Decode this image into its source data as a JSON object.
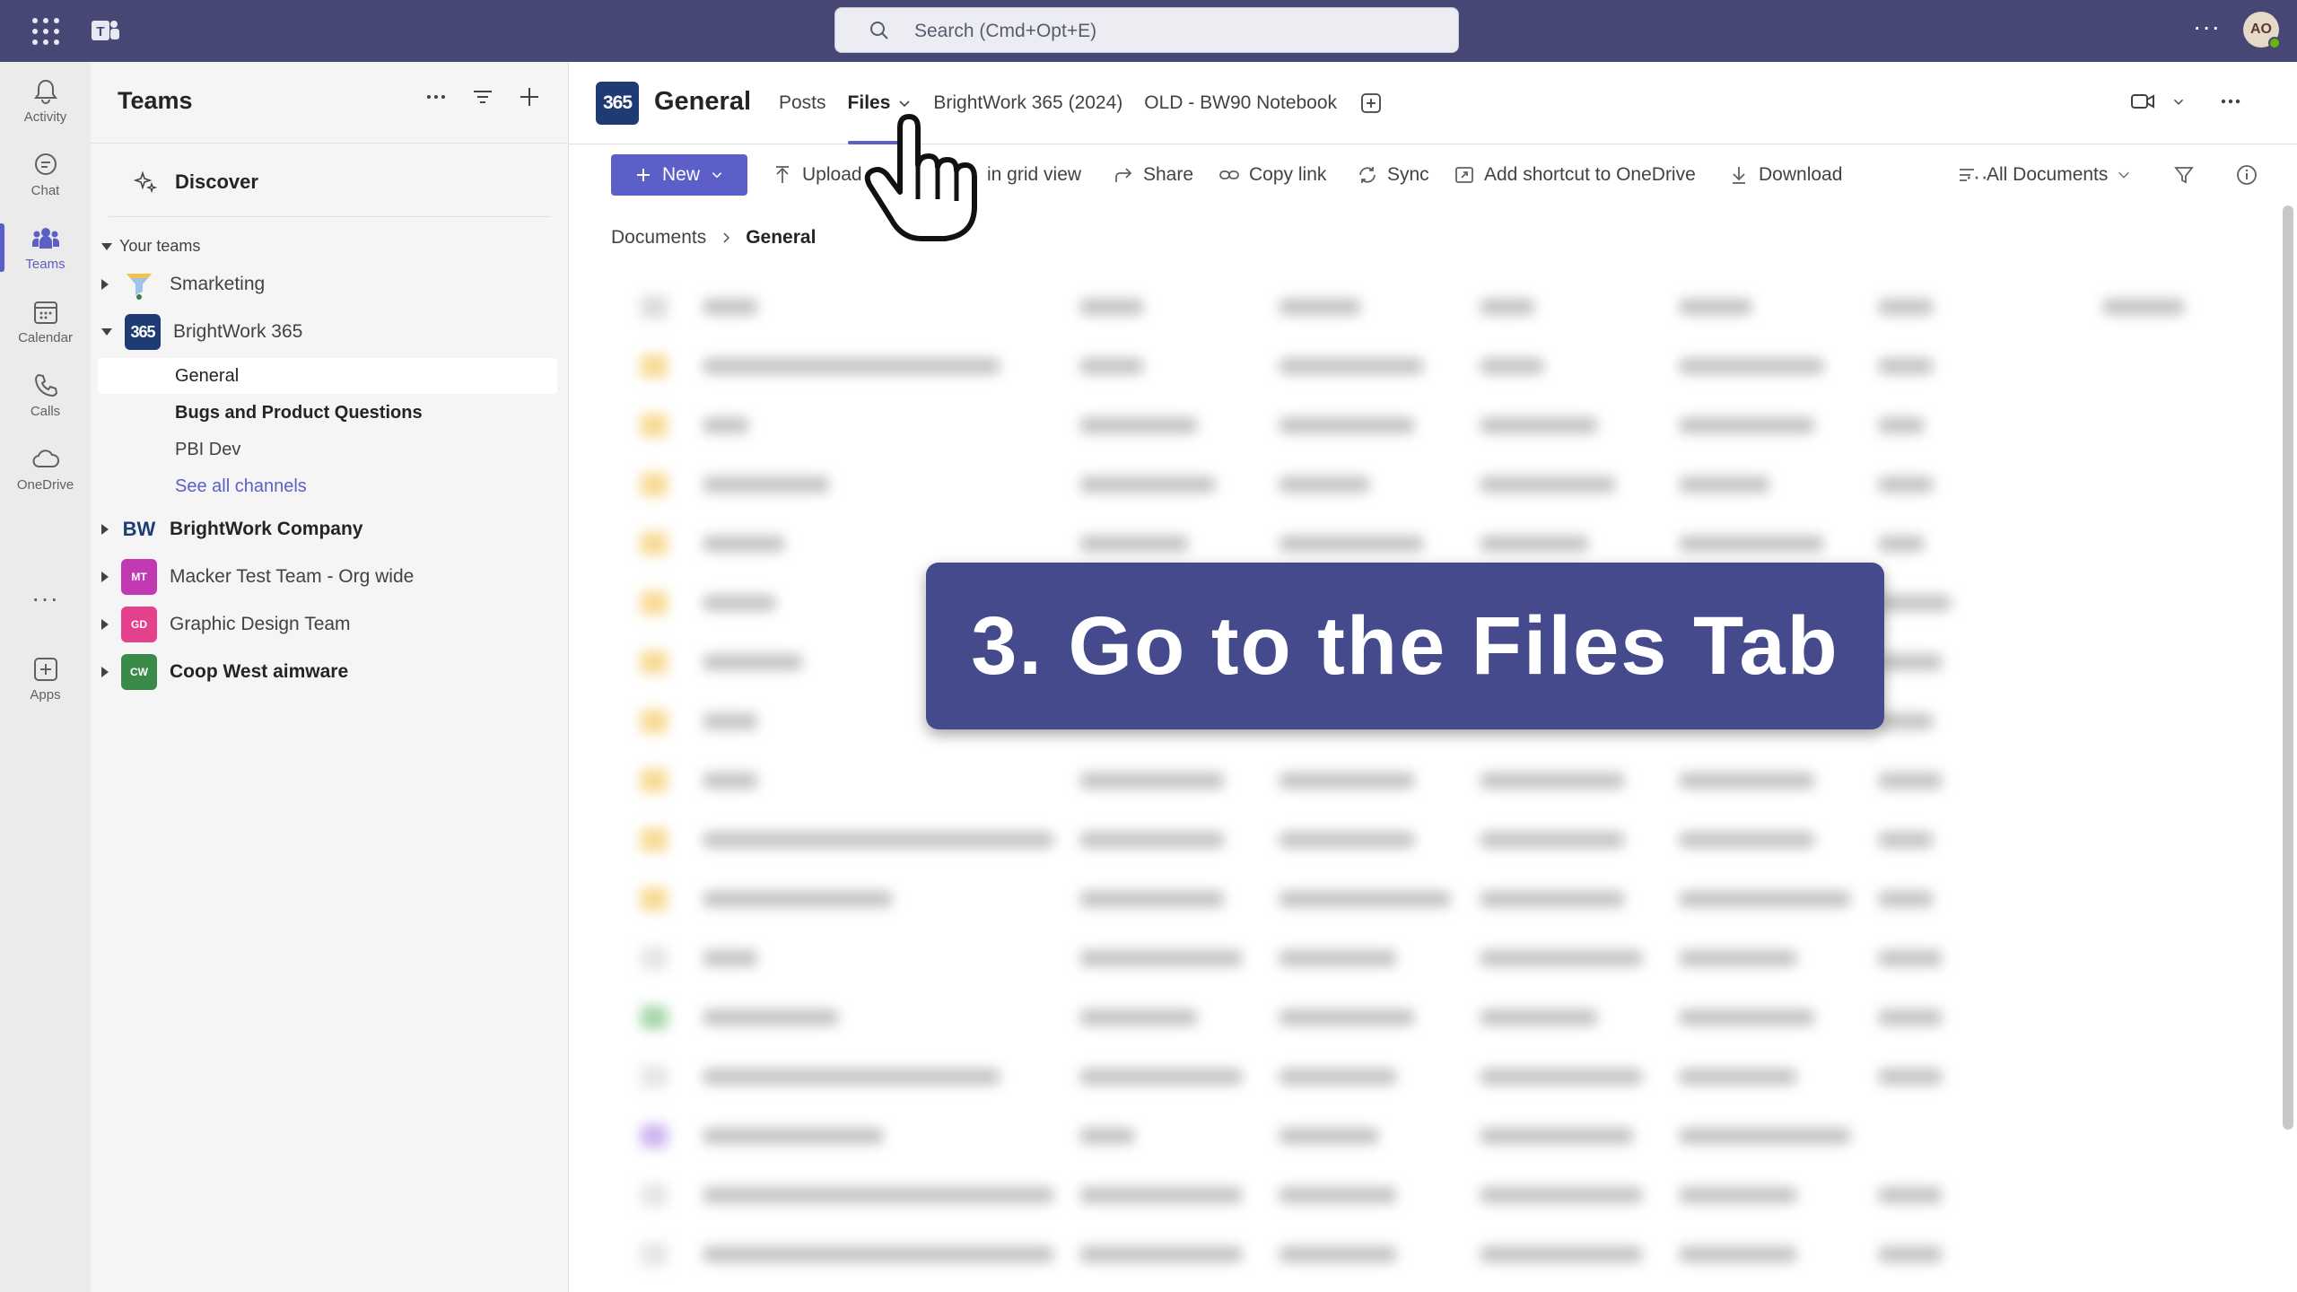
{
  "topbar": {
    "search_placeholder": "Search (Cmd+Opt+E)",
    "more": "···",
    "avatar_initials": "AO"
  },
  "rail": {
    "items": [
      {
        "label": "Activity",
        "icon": "bell-icon"
      },
      {
        "label": "Chat",
        "icon": "chat-icon"
      },
      {
        "label": "Teams",
        "icon": "teams-icon"
      },
      {
        "label": "Calendar",
        "icon": "calendar-icon"
      },
      {
        "label": "Calls",
        "icon": "phone-icon"
      },
      {
        "label": "OneDrive",
        "icon": "cloud-icon"
      },
      {
        "label": "Apps",
        "icon": "apps-add-icon"
      }
    ],
    "more": "···"
  },
  "panel": {
    "title": "Teams",
    "discover": "Discover",
    "section": "Your teams",
    "teams": [
      {
        "name": "Smarketing",
        "avatar": ""
      },
      {
        "name": "BrightWork 365",
        "avatar": "365"
      },
      {
        "name": "BrightWork Company",
        "avatar": "BW"
      },
      {
        "name": "Macker Test Team - Org wide",
        "avatar": "MT"
      },
      {
        "name": "Graphic Design Team",
        "avatar": "GD"
      },
      {
        "name": "Coop West aimware",
        "avatar": "CW"
      }
    ],
    "channels": [
      "General",
      "Bugs and Product Questions",
      "PBI Dev",
      "See all channels"
    ]
  },
  "channel": {
    "logo": "365",
    "title": "General",
    "tabs": [
      "Posts",
      "Files",
      "BrightWork 365 (2024)",
      "OLD - BW90 Notebook"
    ]
  },
  "cmdbar": {
    "new": "New",
    "upload": "Upload",
    "grid": "in grid view",
    "share": "Share",
    "copy_link": "Copy link",
    "sync": "Sync",
    "shortcut": "Add shortcut to OneDrive",
    "download": "Download",
    "more": "···",
    "view": "All Documents"
  },
  "breadcrumb": {
    "root": "Documents",
    "current": "General"
  },
  "overlay": {
    "text": "3. Go to the Files Tab"
  },
  "colors": {
    "topbar": "#464775",
    "accent": "#5b5fc7",
    "callout": "#444a8c"
  }
}
